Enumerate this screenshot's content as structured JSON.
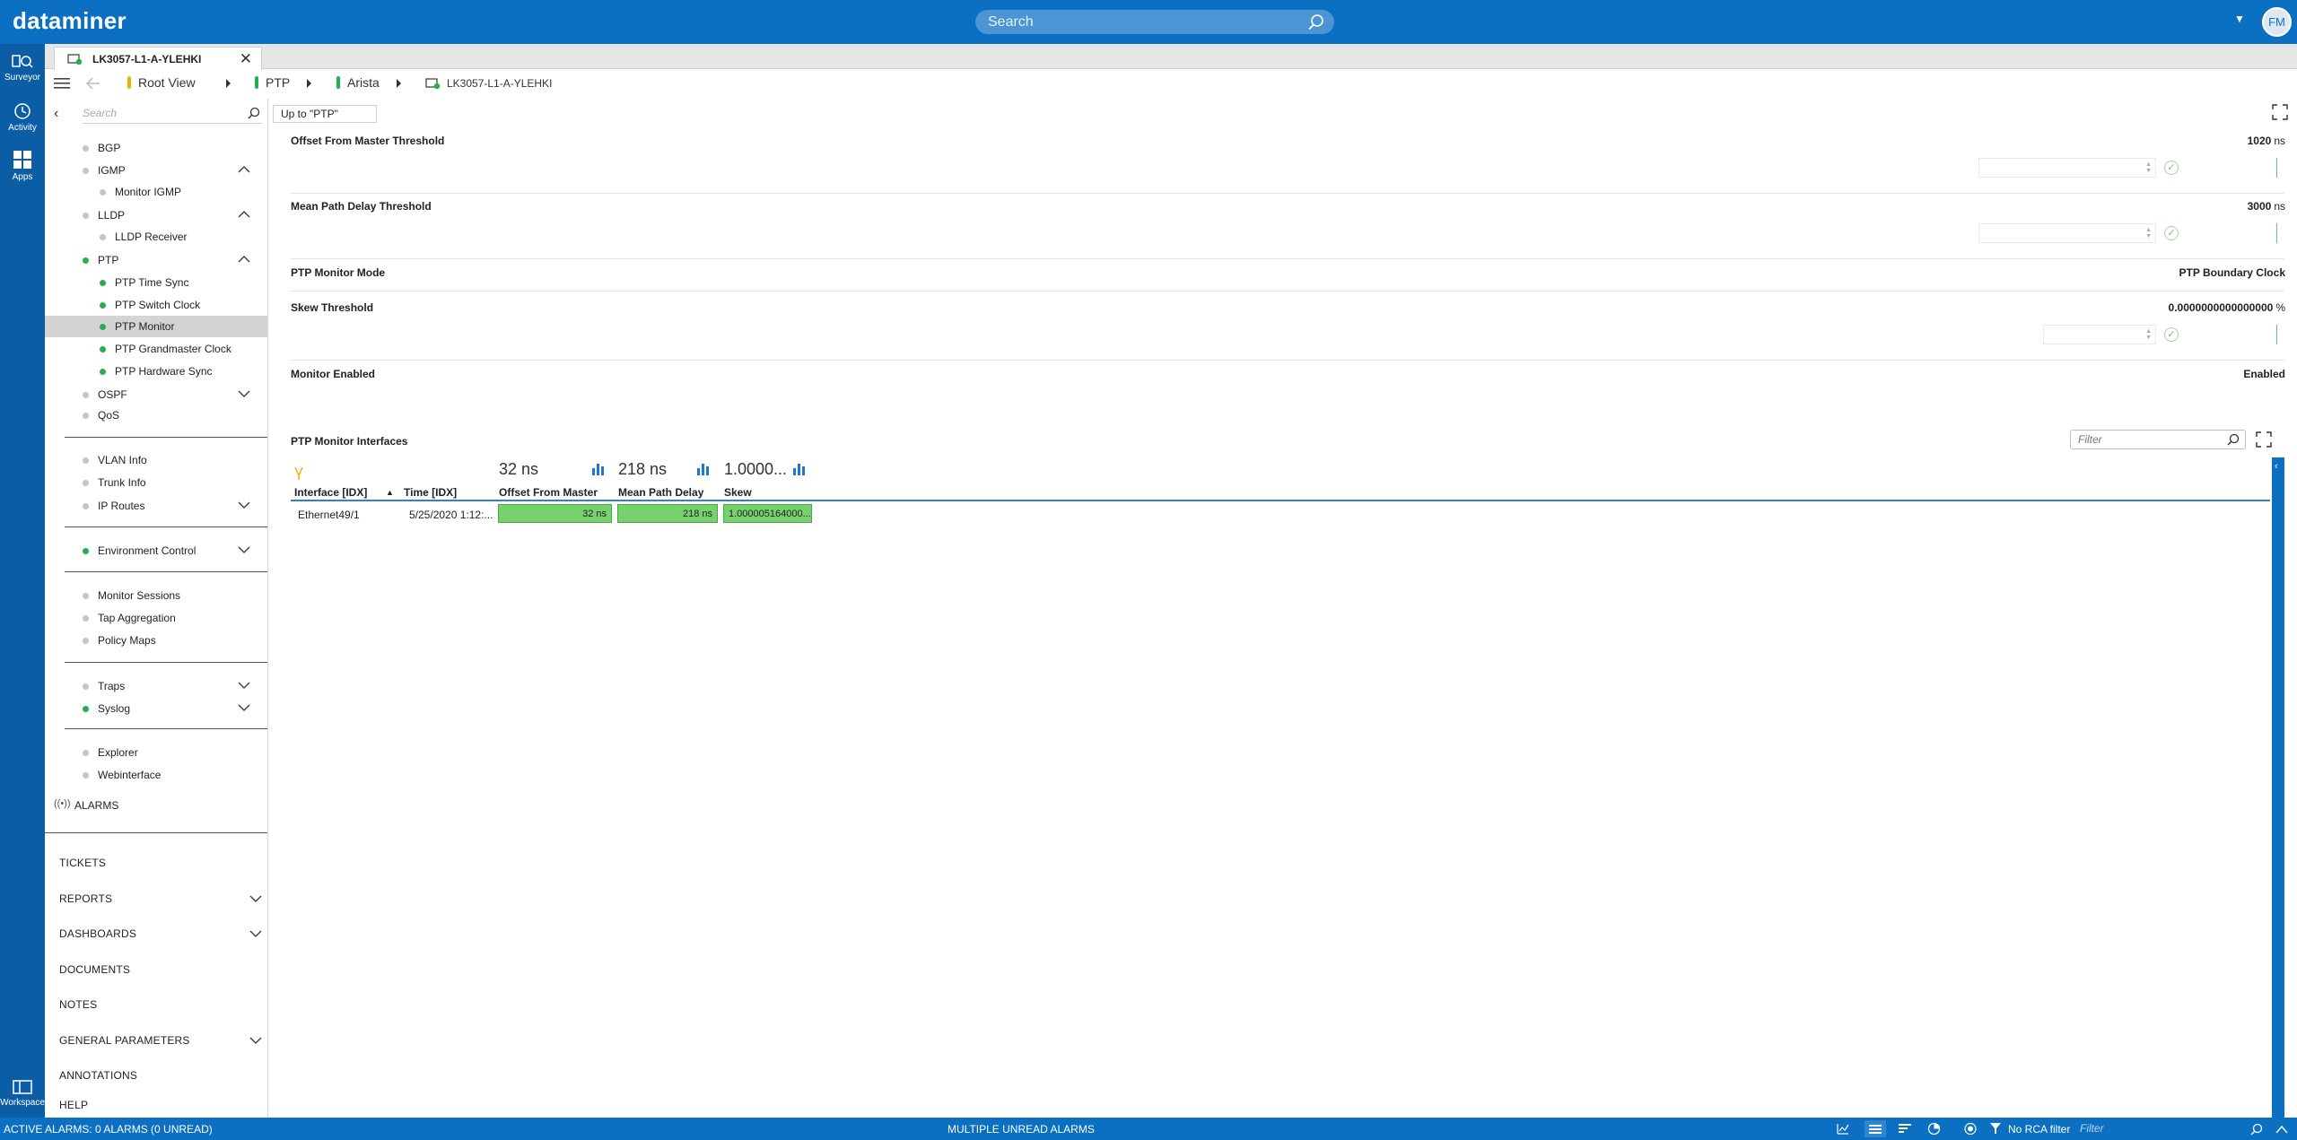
{
  "app": {
    "logo": "dataminer",
    "search_placeholder": "Search",
    "user_initials": "FM"
  },
  "rail": [
    {
      "label": "Surveyor",
      "icon": "surveyor-icon"
    },
    {
      "label": "Activity",
      "icon": "activity-icon"
    },
    {
      "label": "Apps",
      "icon": "apps-icon"
    },
    {
      "label": "Workspace",
      "icon": "workspace-icon"
    }
  ],
  "tab": {
    "title": "LK3057-L1-A-YLEHKI"
  },
  "breadcrumb": {
    "root": "Root View",
    "ptp": "PTP",
    "arista": "Arista",
    "element": "LK3057-L1-A-YLEHKI"
  },
  "sidebar": {
    "search_placeholder": "Search",
    "items": [
      {
        "label": "BGP"
      },
      {
        "label": "IGMP"
      },
      {
        "label": "Monitor IGMP"
      },
      {
        "label": "LLDP"
      },
      {
        "label": "LLDP Receiver"
      },
      {
        "label": "PTP"
      },
      {
        "label": "PTP Time Sync"
      },
      {
        "label": "PTP Switch Clock"
      },
      {
        "label": "PTP Monitor"
      },
      {
        "label": "PTP Grandmaster Clock"
      },
      {
        "label": "PTP Hardware Sync"
      },
      {
        "label": "OSPF"
      },
      {
        "label": "QoS"
      },
      {
        "label": "VLAN Info"
      },
      {
        "label": "Trunk Info"
      },
      {
        "label": "IP Routes"
      },
      {
        "label": "Environment Control"
      },
      {
        "label": "Monitor Sessions"
      },
      {
        "label": "Tap Aggregation"
      },
      {
        "label": "Policy Maps"
      },
      {
        "label": "Traps"
      },
      {
        "label": "Syslog"
      },
      {
        "label": "Explorer"
      },
      {
        "label": "Webinterface"
      }
    ],
    "alarms": "ALARMS",
    "sections": [
      "TICKETS",
      "REPORTS",
      "DASHBOARDS",
      "DOCUMENTS",
      "NOTES",
      "GENERAL PARAMETERS",
      "ANNOTATIONS",
      "HELP"
    ]
  },
  "main": {
    "up_button": "Up to \"PTP\"",
    "params": [
      {
        "name": "Offset From Master Threshold",
        "value": "1020",
        "unit": "ns"
      },
      {
        "name": "Mean Path Delay Threshold",
        "value": "3000",
        "unit": "ns"
      },
      {
        "name": "PTP Monitor Mode",
        "value": "PTP Boundary Clock",
        "unit": ""
      },
      {
        "name": "Skew Threshold",
        "value": "0.0000000000000000",
        "unit": "%"
      },
      {
        "name": "Monitor Enabled",
        "value": "Enabled",
        "unit": ""
      }
    ],
    "table": {
      "title": "PTP Monitor Interfaces",
      "filter_placeholder": "Filter",
      "stats": [
        "32 ns",
        "218 ns",
        "1.0000..."
      ],
      "headers": [
        "Interface [IDX]",
        "Time [IDX]",
        "Offset From Master",
        "Mean Path Delay",
        "Skew"
      ],
      "rows": [
        {
          "interface": "Ethernet49/1",
          "time": "5/25/2020 1:12:...",
          "offset": "32 ns",
          "delay": "218 ns",
          "skew": "1.000005164000..."
        }
      ]
    }
  },
  "statusbar": {
    "left": "ACTIVE ALARMS: 0 ALARMS (0 UNREAD)",
    "center": "MULTIPLE UNREAD ALARMS",
    "rca": "No RCA filter",
    "filter_placeholder": "Filter"
  },
  "colors": {
    "brand": "#0b6fc2",
    "ok_green": "#22b14c",
    "cell_green": "#77d26e"
  }
}
